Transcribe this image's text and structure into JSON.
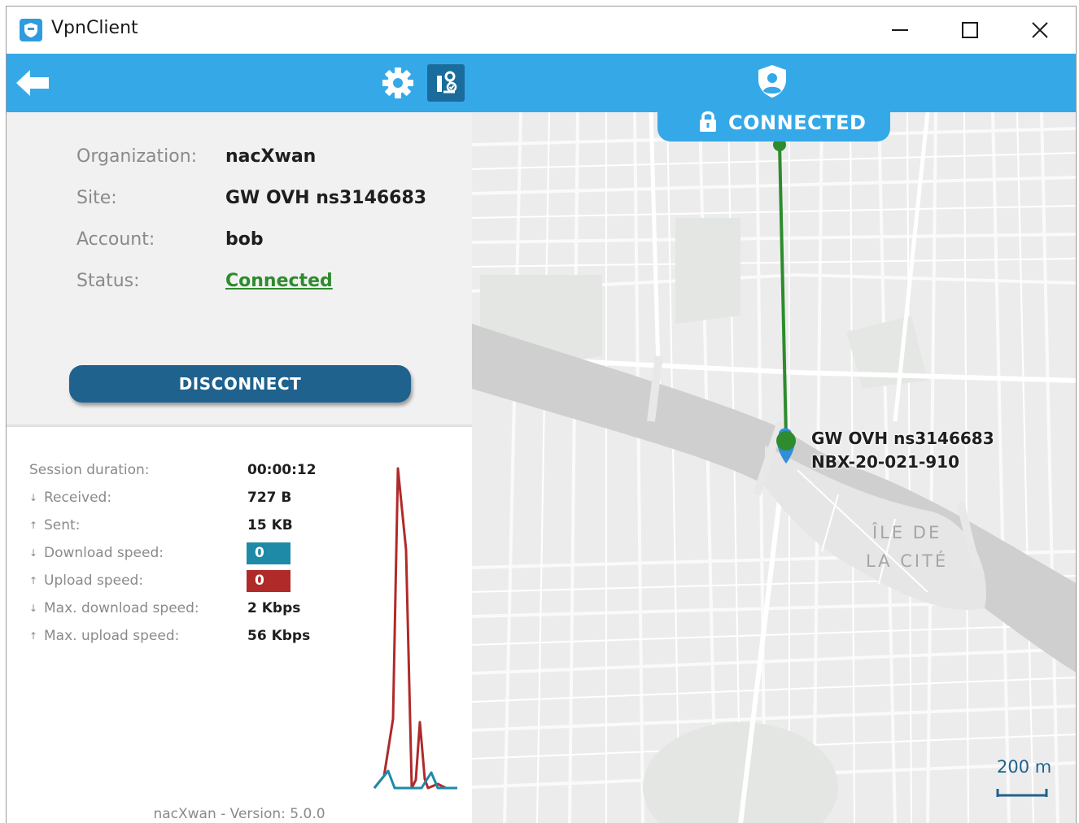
{
  "window": {
    "title": "VpnClient"
  },
  "status_tab": {
    "label": "CONNECTED"
  },
  "info": {
    "organization": {
      "label": "Organization:",
      "value": "nacXwan"
    },
    "site": {
      "label": "Site:",
      "value": "GW OVH ns3146683"
    },
    "account": {
      "label": "Account:",
      "value": "bob"
    },
    "status": {
      "label": "Status:",
      "value": "Connected"
    }
  },
  "disconnect_label": "DISCONNECT",
  "stats": {
    "session_duration": {
      "label": "Session duration:",
      "value": "00:00:12"
    },
    "received": {
      "arrow": "↓",
      "label": "Received:",
      "value": "727 B"
    },
    "sent": {
      "arrow": "↑",
      "label": "Sent:",
      "value": "15 KB"
    },
    "download_speed": {
      "arrow": "↓",
      "label": "Download speed:",
      "value": "0 bps"
    },
    "upload_speed": {
      "arrow": "↑",
      "label": "Upload speed:",
      "value": "0 bps"
    },
    "max_download": {
      "arrow": "↓",
      "label": "Max. download speed:",
      "value": "2 Kbps"
    },
    "max_upload": {
      "arrow": "↑",
      "label": "Max. upload speed:",
      "value": "56 Kbps"
    }
  },
  "version_text": "nacXwan - Version: 5.0.0",
  "map": {
    "site_name": "GW OVH ns3146683",
    "site_id": "NBX-20-021-910",
    "district_line1": "ÎLE DE",
    "district_line2": "LA CITÉ",
    "scale_label": "200 m"
  },
  "colors": {
    "toolbar": "#35a9e8",
    "disconnect": "#1f628e",
    "connected_green": "#2e8b2e",
    "download_series": "#1e8aa8",
    "upload_series": "#b02a2a"
  }
}
